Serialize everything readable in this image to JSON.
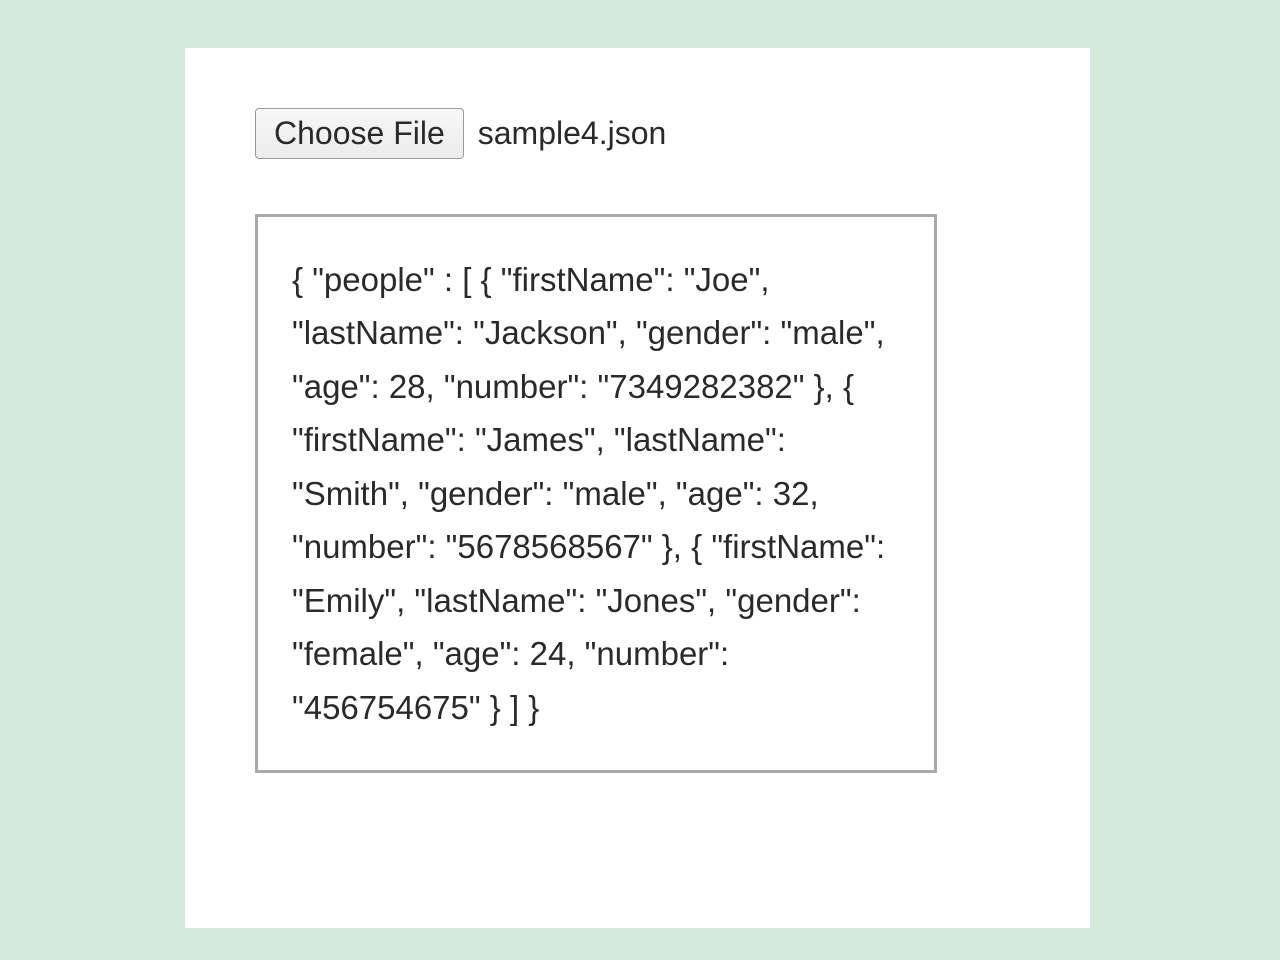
{
  "fileInput": {
    "buttonLabel": "Choose File",
    "selectedFile": "sample4.json"
  },
  "jsonContent": "{ \"people\" : [ { \"firstName\": \"Joe\", \"lastName\": \"Jackson\", \"gender\": \"male\", \"age\": 28, \"number\": \"7349282382\" }, { \"firstName\": \"James\", \"lastName\": \"Smith\", \"gender\": \"male\", \"age\": 32, \"number\": \"5678568567\" }, { \"firstName\": \"Emily\", \"lastName\": \"Jones\", \"gender\": \"female\", \"age\": 24, \"number\": \"456754675\" } ] }"
}
